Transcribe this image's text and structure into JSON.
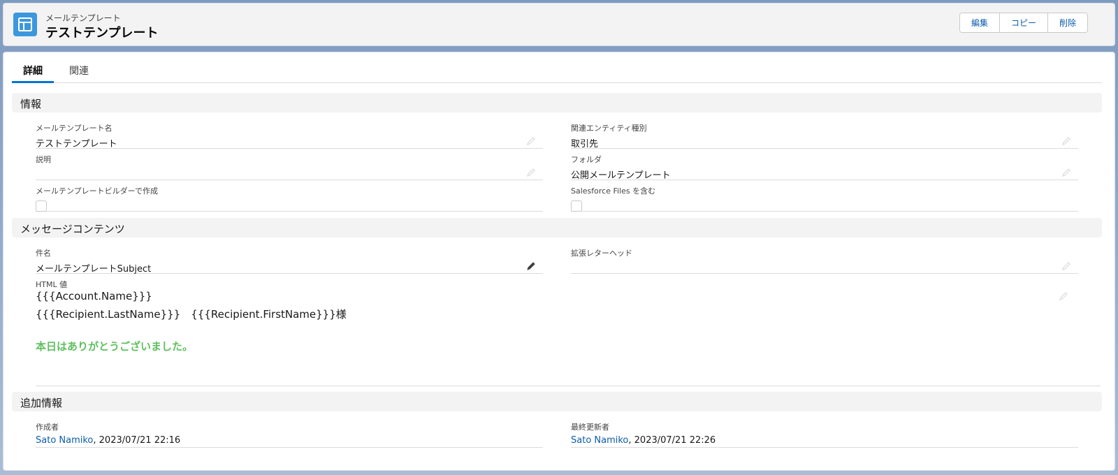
{
  "header": {
    "object_type": "メールテンプレート",
    "title": "テストテンプレート",
    "buttons": {
      "edit": "編集",
      "copy": "コピー",
      "delete": "削除"
    }
  },
  "tabs": {
    "details": "詳細",
    "related": "関連"
  },
  "sections": {
    "info": {
      "title": "情報",
      "template_name_label": "メールテンプレート名",
      "template_name_value": "テストテンプレート",
      "entity_label": "関連エンティティ種別",
      "entity_value": "取引先",
      "description_label": "説明",
      "description_value": "",
      "folder_label": "フォルダ",
      "folder_value": "公開メールテンプレート",
      "builder_label": "メールテンプレートビルダーで作成",
      "files_label": "Salesforce Files を含む"
    },
    "content": {
      "title": "メッセージコンテンツ",
      "subject_label": "件名",
      "subject_value": "メールテンプレートSubject",
      "letterhead_label": "拡張レターヘッド",
      "letterhead_value": "",
      "html_label": "HTML 値",
      "html_line1": "{{{Account.Name}}}",
      "html_line2": "{{{Recipient.LastName}}}　{{{Recipient.FirstName}}}様",
      "html_greeting": "本日はありがとうございました。"
    },
    "additional": {
      "title": "追加情報",
      "created_label": "作成者",
      "created_user": "Sato Namiko",
      "created_time": ", 2023/07/21 22:16",
      "modified_label": "最終更新者",
      "modified_user": "Sato Namiko",
      "modified_time": ", 2023/07/21 22:26"
    }
  },
  "colors": {
    "accent": "#0176d3",
    "link": "#0b5cab",
    "icon_bg": "#3c97dd",
    "greeting": "#5fbf5f"
  }
}
